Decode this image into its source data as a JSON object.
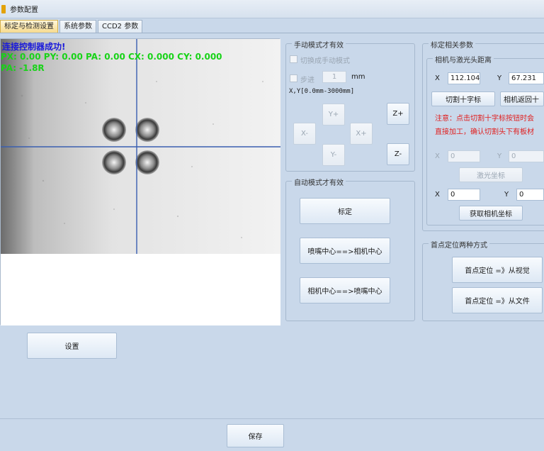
{
  "window": {
    "title": "参数配置"
  },
  "tabs": [
    {
      "label": "标定与检测设置",
      "active": true
    },
    {
      "label": "系统参数",
      "active": false
    },
    {
      "label": "CCD2 参数",
      "active": false
    }
  ],
  "camera": {
    "status_text": "连接控制器成功!",
    "coords_line": "PX: 0.00 PY: 0.00 PA: 0.00 CX: 0.000 CY: 0.000",
    "angle_line": "PA: -1.8R"
  },
  "manual": {
    "legend": "手动模式才有效",
    "switch_label": "切换成手动模式",
    "step_label": "步进",
    "step_value": "1",
    "step_unit": "mm",
    "range_text": "X,Y[0.0mm-3000mm]",
    "y_plus": "Y+",
    "y_minus": "Y-",
    "x_minus": "X-",
    "x_plus": "X+",
    "z_plus": "Z+",
    "z_minus": "Z-"
  },
  "auto": {
    "legend": "自动模式才有效",
    "calibrate": "标定",
    "nozzle_to_camera": "喷嘴中心==>相机中心",
    "camera_to_nozzle": "相机中心==>喷嘴中心"
  },
  "calib": {
    "legend": "标定相关参数",
    "sub_legend": "相机与激光头距离",
    "x_label": "X",
    "x_value": "112.104",
    "y_label": "Y",
    "y_value": "67.231",
    "cut_cross": "切割十字标",
    "camera_return": "相机返回十",
    "note_line1": "注意：点击切割十字标按钮时会",
    "note_line2": "直接加工，确认切割头下有板材",
    "x2_label": "X",
    "x2_value": "0",
    "y2_label": "Y",
    "y2_value": "0",
    "laser_coord": "激光坐标",
    "x3_label": "X",
    "x3_value": "0",
    "y3_label": "Y",
    "y3_value": "0",
    "get_camera_coord": "获取相机坐标"
  },
  "first_point": {
    "legend": "首点定位两种方式",
    "from_vision": "首点定位 =》从视觉",
    "from_file": "首点定位 =》从文件"
  },
  "settings_button": "设置",
  "save_button": "保存",
  "colors": {
    "status_blue": "#1a1adb",
    "coords_green": "#18d318",
    "crosshair": "#3a5fb0",
    "warning_red": "#e02020"
  }
}
